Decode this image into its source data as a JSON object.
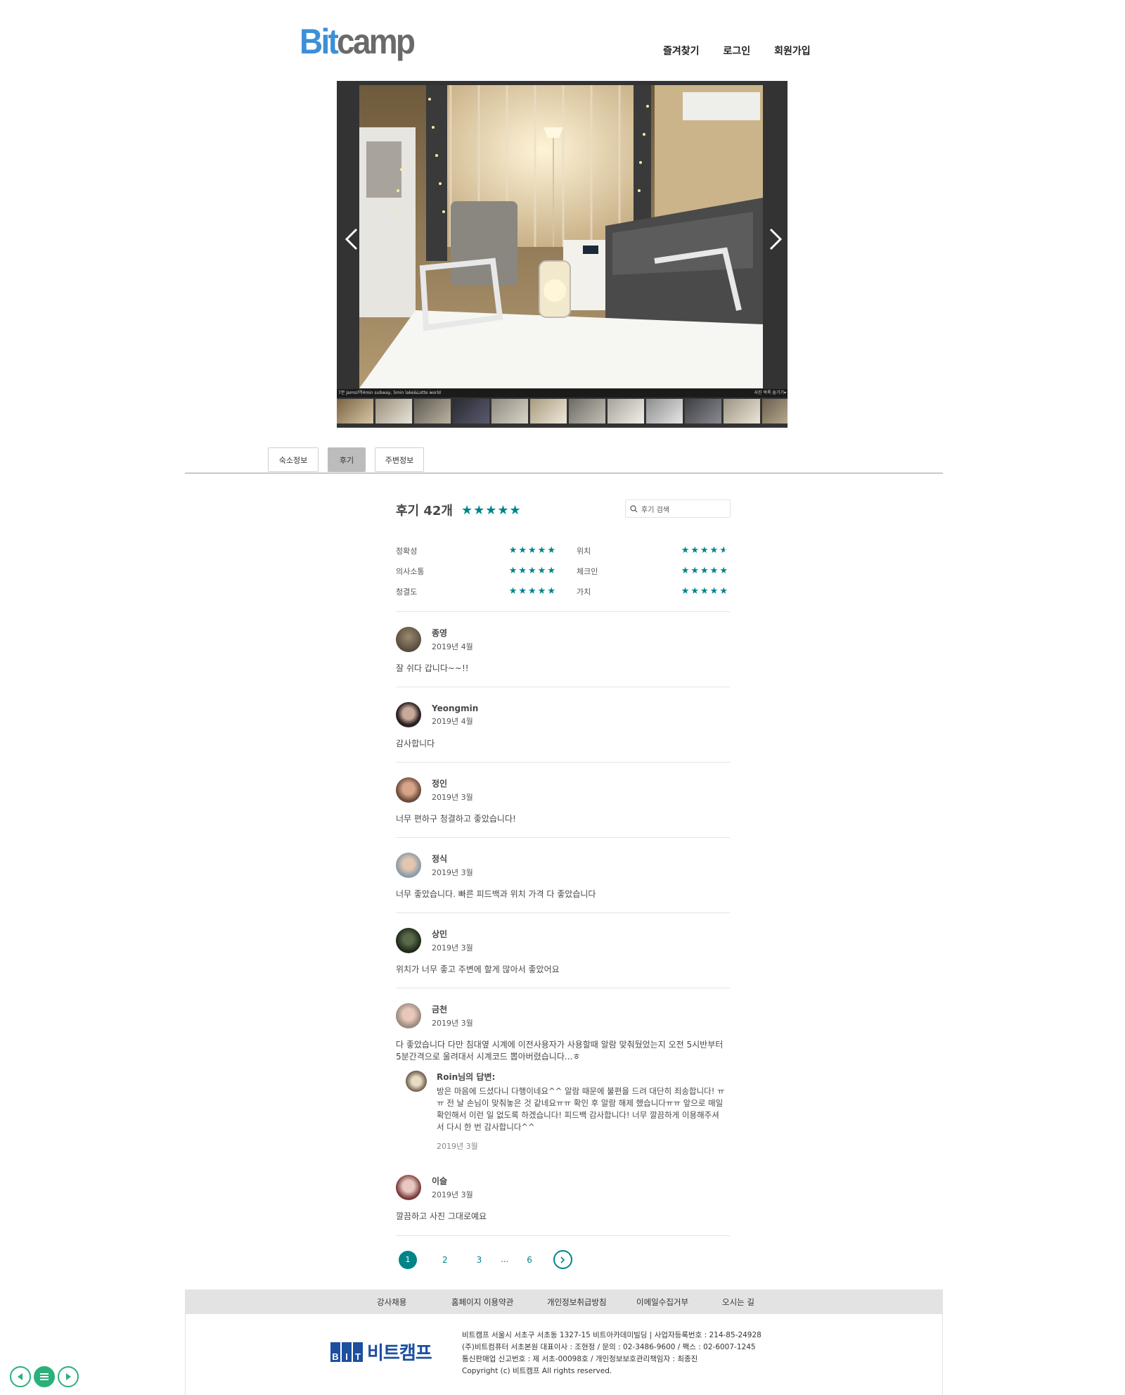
{
  "header": {
    "logo_part1": "Bit",
    "logo_part2": "camp",
    "nav": [
      "즐겨찾기",
      "로그인",
      "회원가입"
    ]
  },
  "gallery": {
    "caption_left": "7분 Jamsil역4min subway, 5min lake&Lotte world",
    "caption_right": "사진 목록 숨기기▾",
    "thumb_count": 12
  },
  "tabs": [
    {
      "label": "숙소정보",
      "active": false
    },
    {
      "label": "후기",
      "active": true
    },
    {
      "label": "주변정보",
      "active": false
    }
  ],
  "reviews_summary": {
    "title": "후기 42개",
    "overall_stars": 5,
    "search_placeholder": "후기 검색",
    "categories": [
      {
        "label": "정확성",
        "stars": 5
      },
      {
        "label": "위치",
        "stars": 4.5
      },
      {
        "label": "의사소통",
        "stars": 5
      },
      {
        "label": "체크인",
        "stars": 5
      },
      {
        "label": "청결도",
        "stars": 5
      },
      {
        "label": "가치",
        "stars": 5
      }
    ]
  },
  "reviews": [
    {
      "name": "종영",
      "date": "2019년 4월",
      "text": "잘 쉬다 갑니다~~!!"
    },
    {
      "name": "Yeongmin",
      "date": "2019년 4월",
      "text": "감사합니다"
    },
    {
      "name": "정인",
      "date": "2019년 3월",
      "text": "너무 편하구 청결하고 좋았습니다!"
    },
    {
      "name": "정식",
      "date": "2019년 3월",
      "text": "너무 좋았습니다. 빠른 피드백과 위치 가격 다 좋았습니다"
    },
    {
      "name": "상민",
      "date": "2019년 3월",
      "text": "위치가 너무 좋고 주변에 할게 많아서 좋았어요"
    },
    {
      "name": "금천",
      "date": "2019년 3월",
      "text": "다 좋았습니다 다만 침대옆 시계에 이전사용자가 사용할때 알람 맞춰뒀었는지 오전 5시반부터 5분간격으로 울려대서 시계코드 뽑아버렸습니다...ㅎ"
    },
    {
      "name": "이슬",
      "date": "2019년 3월",
      "text": "깔끔하고 사진 그대로예요"
    }
  ],
  "reply": {
    "name": "Roin님의 답변:",
    "text": "방은 마음에 드셨다니 다행이네요^^ 알람 때문에 불편을 드려 대단히 죄송합니다! ㅠㅠ 전 날 손님이 맞춰놓은 것 같네요ㅠㅠ 확인 후 알람 해제 했습니다ㅠㅠ 앞으로 매일 확인해서 이런 일 없도록 하겠습니다! 피드백 감사합니다! 너무 깔끔하게 이용해주셔서 다시 한 번 감사합니다^^",
    "date": "2019년 3월"
  },
  "pagination": {
    "pages": [
      "1",
      "2",
      "3",
      "…",
      "6"
    ],
    "current": "1"
  },
  "footer": {
    "links": [
      "강사채용",
      "홈페이지 이용약관",
      "개인정보취급방침",
      "이메일수집거부",
      "오시는 길"
    ],
    "logo_letters": [
      "B",
      "I",
      "T"
    ],
    "logo_text": "비트캠프",
    "info": [
      "비트캠프 서울시 서초구 서초동 1327-15 비트아카데미빌딩 | 사업자등록번호 : 214-85-24928",
      "(주)비트컴퓨터 서초본원 대표이사 : 조현정 / 문의 : 02-3486-9600 / 팩스 : 02-6007-1245",
      "통신판매업 신고번호 : 제 서초-00098호 / 개인정보보호관리책임자 : 최종진",
      "Copyright (c) 비트캠프 All rights reserved."
    ]
  },
  "colors": {
    "accent": "#008489",
    "logo_blue": "#3d8fd6",
    "footer_blue": "#1d4fa0",
    "control_green": "#2bb07a"
  }
}
